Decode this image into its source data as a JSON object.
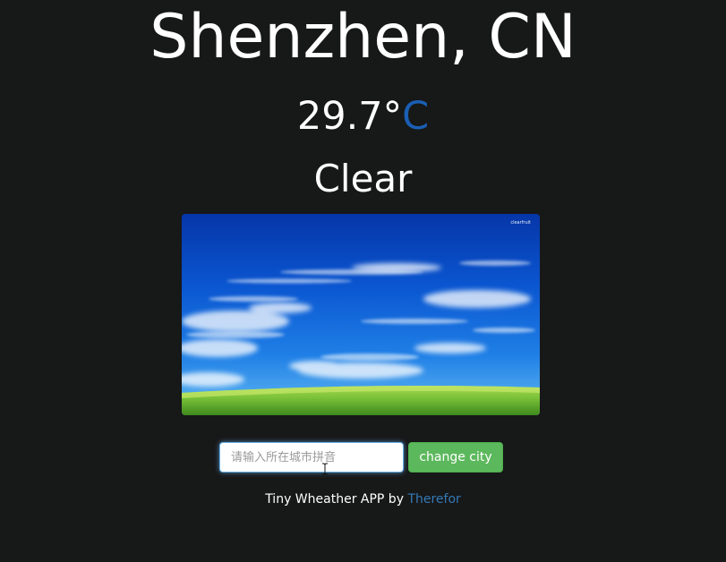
{
  "weather": {
    "city": "Shenzhen, CN",
    "temperature": "29.7°",
    "unit": "C",
    "condition": "Clear",
    "image_corner_text": "clearfruit"
  },
  "search": {
    "placeholder": "请输入所在城市拼音",
    "value": "",
    "button_label": "change city"
  },
  "footer": {
    "text": "Tiny Wheather APP by ",
    "author_link": "Therefor"
  },
  "colors": {
    "background": "#171818",
    "unit_accent": "#1a5fb4",
    "button_green": "#5cb85c",
    "link_blue": "#337ab7"
  }
}
